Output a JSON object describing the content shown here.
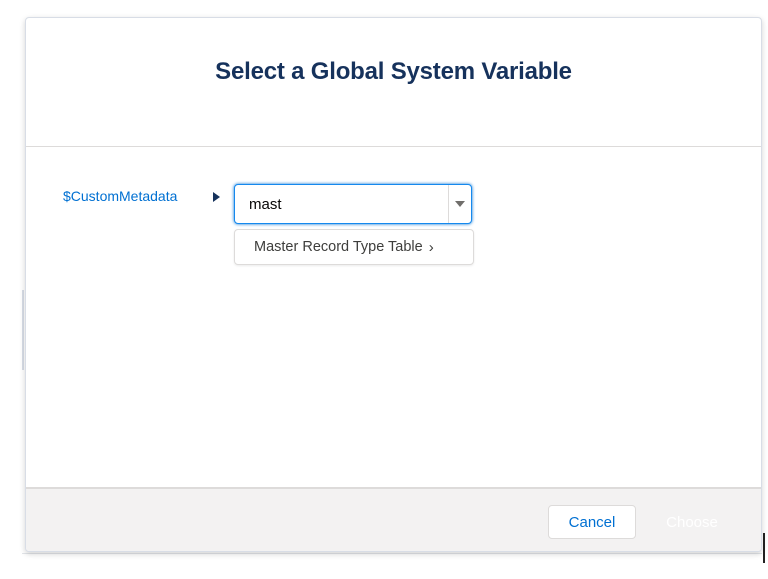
{
  "modal": {
    "title": "Select a Global System Variable"
  },
  "body": {
    "variable_label": "$CustomMetadata",
    "expand_icon": "caret-right-icon",
    "combobox": {
      "value": "mast",
      "placeholder": "",
      "toggle_icon": "caret-down-icon"
    },
    "dropdown": {
      "items": [
        {
          "label": "Master Record Type Table",
          "icon": "chevron-right-icon",
          "icon_glyph": "›"
        }
      ]
    }
  },
  "footer": {
    "cancel_label": "Cancel",
    "choose_label": "Choose"
  },
  "colors": {
    "link": "#0070d2",
    "title": "#16325c",
    "footer_bg": "#f3f2f2",
    "focus_border": "#1589ee"
  }
}
